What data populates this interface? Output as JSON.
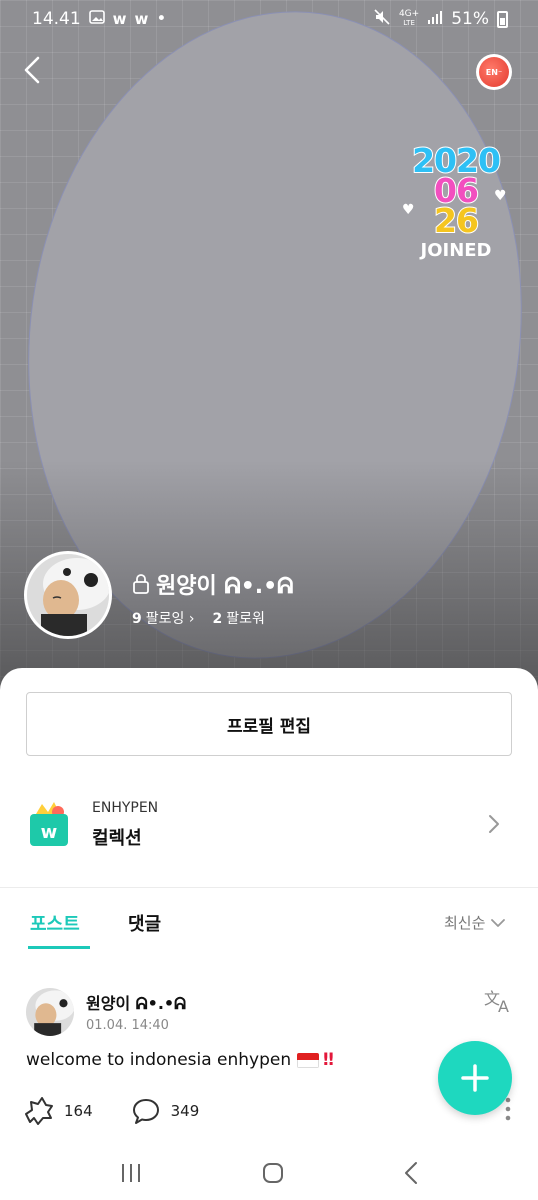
{
  "status_bar": {
    "time": "14.41",
    "left_icons": [
      "image-icon",
      "weverse-icon",
      "weverse-icon",
      "dot-icon"
    ],
    "network": "4G+",
    "network_sub": "LTE",
    "battery": "51%"
  },
  "header": {
    "joined": {
      "year": "2020",
      "month": "06",
      "day": "26",
      "label": "JOINED"
    },
    "profile": {
      "name": "원양이 ᕱ•.•ᕱ",
      "following_count": "9",
      "following_label": "팔로잉",
      "followers_count": "2",
      "followers_label": "팔로워"
    }
  },
  "edit_profile_label": "프로필 편집",
  "collection": {
    "artist": "ENHYPEN",
    "title": "컬렉션"
  },
  "tabs": {
    "posts": "포스트",
    "comments": "댓글",
    "sort": "최신순"
  },
  "post": {
    "author": "원양이 ᕱ•.•ᕱ",
    "date": "01.04. 14:40",
    "text": "welcome to indonesia enhypen",
    "emoji_suffix": "‼",
    "likes": "164",
    "comments": "349"
  },
  "colors": {
    "accent": "#1cc9b9",
    "fab": "#1ed8bf",
    "joined_year": "#2ec0f5",
    "joined_month": "#f24fbf",
    "joined_day": "#f5c51f"
  }
}
